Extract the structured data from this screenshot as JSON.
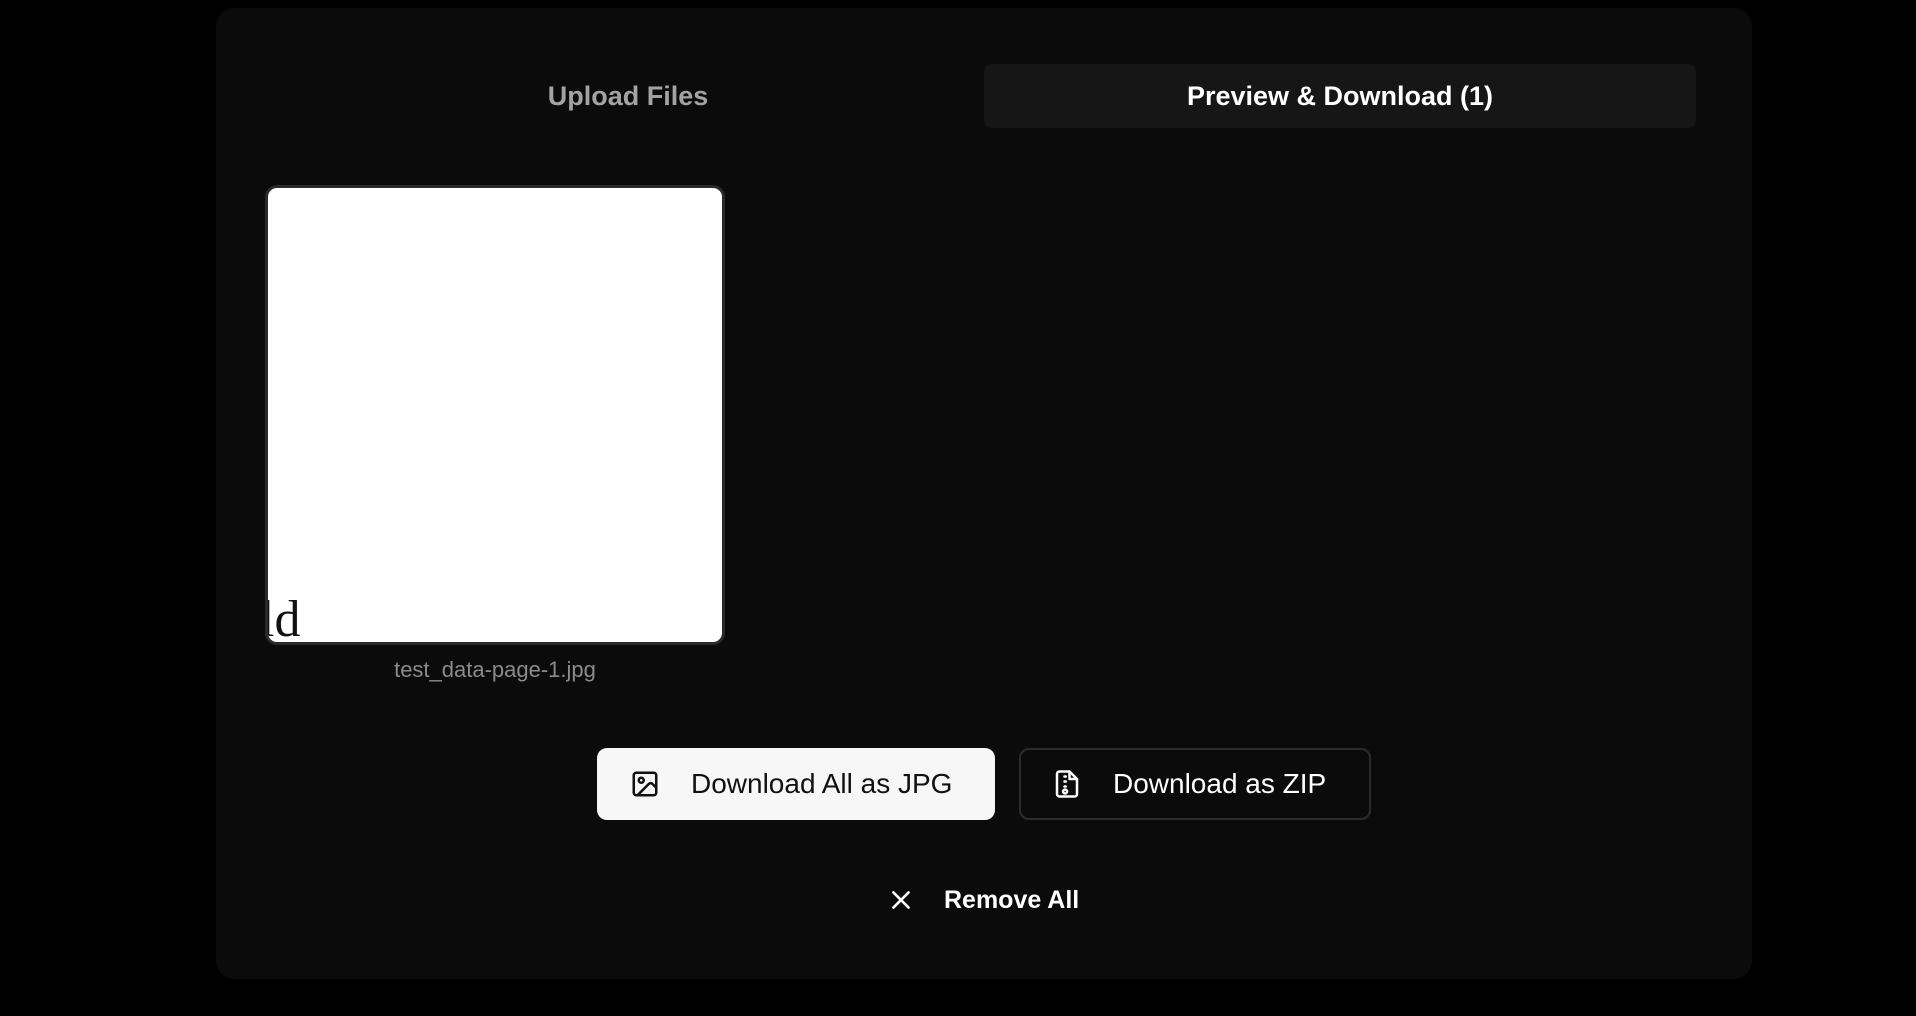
{
  "tabs": [
    {
      "label": "Upload Files",
      "active": false
    },
    {
      "label": "Preview & Download (1)",
      "active": true
    }
  ],
  "preview": {
    "file_name": "test_data-page-1.jpg",
    "image_text": "ld"
  },
  "actions": {
    "download_jpg_label": "Download All as JPG",
    "download_jpg_icon": "image-icon",
    "download_zip_label": "Download as ZIP",
    "download_zip_icon": "file-zip-icon",
    "remove_all_label": "Remove All",
    "remove_all_icon": "close-icon"
  },
  "colors": {
    "background": "#000000",
    "panel": "#0b0b0b",
    "active_tab": "#161616",
    "primary_button": "#f7f7f7"
  }
}
